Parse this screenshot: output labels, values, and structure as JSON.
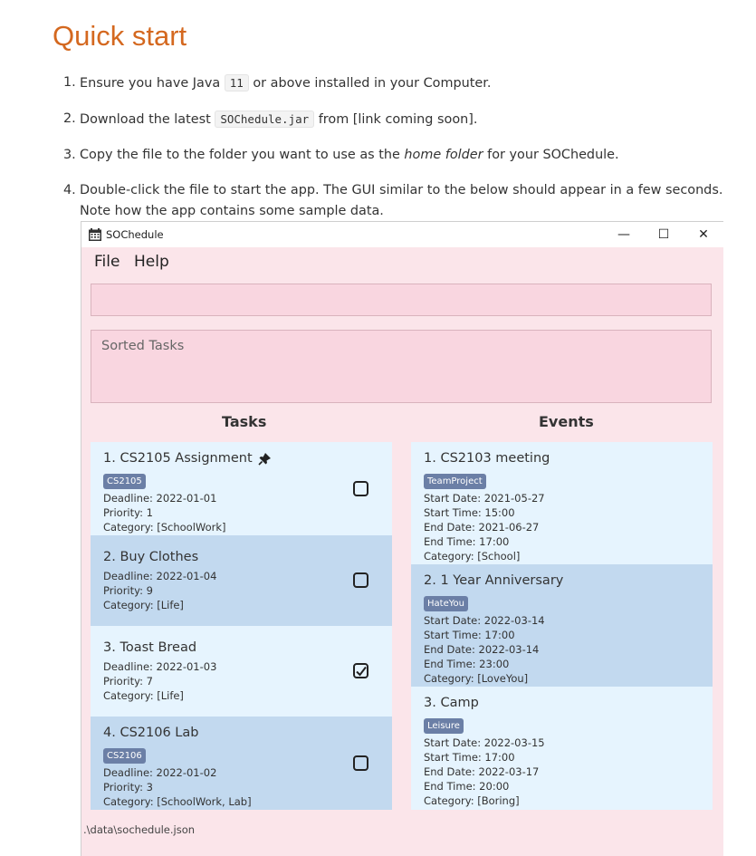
{
  "doc": {
    "title": "Quick start",
    "steps": [
      {
        "num": "1.",
        "a": "Ensure you have Java ",
        "code": "11",
        "b": " or above installed in your Computer."
      },
      {
        "num": "2.",
        "a": "Download the latest ",
        "code": "SOChedule.jar",
        "b": " from [link coming soon]."
      },
      {
        "num": "3.",
        "a": "Copy the file to the folder you want to use as the ",
        "em": "home folder",
        "b": " for your SOChedule."
      },
      {
        "num": "4.",
        "a": "Double-click the file to start the app. The GUI similar to the below should appear in a few seconds.",
        "line2": "Note how the app contains some sample data."
      }
    ]
  },
  "window": {
    "title": "SOChedule",
    "minimize": "—",
    "maximize": "☐",
    "close": "✕",
    "menu": [
      "File",
      "Help"
    ]
  },
  "command_box": {
    "value": ""
  },
  "sorted_tasks": {
    "placeholder": "Sorted Tasks"
  },
  "tasks": {
    "heading": "Tasks",
    "items": [
      {
        "name": "1.  CS2105 Assignment",
        "pinned": true,
        "tags": [
          "CS2105"
        ],
        "deadline": "Deadline: 2022-01-01",
        "priority": "Priority: 1",
        "category": "Category: [SchoolWork]",
        "done": false
      },
      {
        "name": "2.  Buy Clothes",
        "pinned": false,
        "tags": [],
        "deadline": "Deadline: 2022-01-04",
        "priority": "Priority: 9",
        "category": "Category: [Life]",
        "done": false
      },
      {
        "name": "3.  Toast Bread",
        "pinned": false,
        "tags": [],
        "deadline": "Deadline: 2022-01-03",
        "priority": "Priority: 7",
        "category": "Category: [Life]",
        "done": true
      },
      {
        "name": "4.  CS2106 Lab",
        "pinned": false,
        "tags": [
          "CS2106"
        ],
        "deadline": "Deadline: 2022-01-02",
        "priority": "Priority: 3",
        "category": "Category: [SchoolWork, Lab]",
        "done": false
      }
    ]
  },
  "events": {
    "heading": "Events",
    "items": [
      {
        "name": "1.  CS2103 meeting",
        "tags": [
          "TeamProject"
        ],
        "start_date": "Start Date: 2021-05-27",
        "start_time": "Start Time: 15:00",
        "end_date": "End Date: 2021-06-27",
        "end_time": "End Time: 17:00",
        "category": "Category: [School]"
      },
      {
        "name": "2.  1 Year Anniversary",
        "tags": [
          "HateYou"
        ],
        "start_date": "Start Date: 2022-03-14",
        "start_time": "Start Time: 17:00",
        "end_date": "End Date: 2022-03-14",
        "end_time": "End Time: 23:00",
        "category": "Category: [LoveYou]"
      },
      {
        "name": "3.  Camp",
        "tags": [
          "Leisure"
        ],
        "start_date": "Start Date: 2022-03-15",
        "start_time": "Start Time: 17:00",
        "end_date": "End Date: 2022-03-17",
        "end_time": "End Time: 20:00",
        "category": "Category: [Boring]"
      }
    ]
  },
  "status_bar": {
    "path": ".\\data\\sochedule.json"
  },
  "colors": {
    "title_orange": "#d4681f",
    "app_bg": "#fbe5ea",
    "card_light": "#e6f4fe",
    "card_dark": "#c2d9ef",
    "tag_bg": "#6b7fa6"
  }
}
